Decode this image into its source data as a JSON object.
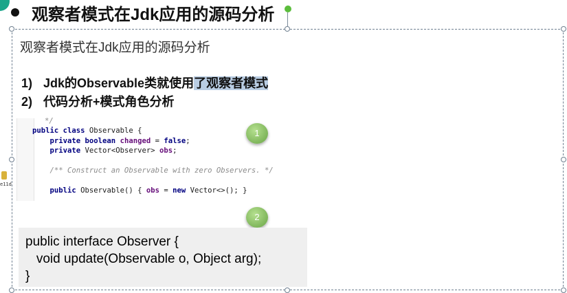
{
  "slide": {
    "title": "观察者模式在Jdk应用的源码分析"
  },
  "box": {
    "heading": "观察者模式在Jdk应用的源码分析",
    "points": [
      {
        "num": "1)",
        "text_plain": "Jdk的Observable类就使用",
        "text_highlight": "了观察者模式"
      },
      {
        "num": "2)",
        "text_plain": "代码分析+模式角色分析",
        "text_highlight": ""
      }
    ]
  },
  "code_observable": {
    "lines": [
      "*/",
      "public class Observable {",
      "    private boolean changed = false;",
      "    private Vector<Observer> obs;",
      "",
      "    /** Construct an Observable with zero Observers. */",
      "",
      "    public Observable() { obs = new Vector<>(); }"
    ]
  },
  "badges": {
    "one": "1",
    "two": "2"
  },
  "code_observer": {
    "lines": [
      "public interface Observer {",
      "   void update(Observable o, Object arg);",
      "}"
    ]
  },
  "side_icon": {
    "label": "e11d"
  },
  "colors": {
    "highlight": "#b9cde3",
    "badge": "#7fb65b",
    "corner": "#1aa68a"
  }
}
